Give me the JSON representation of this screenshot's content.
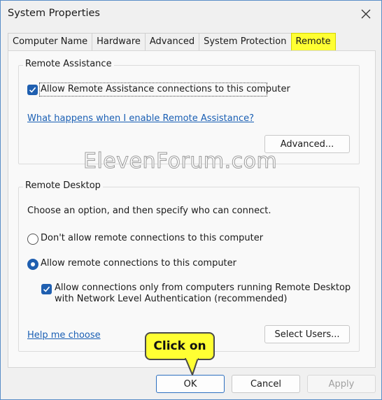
{
  "window": {
    "title": "System Properties"
  },
  "tabs": [
    {
      "label": "Computer Name"
    },
    {
      "label": "Hardware"
    },
    {
      "label": "Advanced"
    },
    {
      "label": "System Protection"
    },
    {
      "label": "Remote"
    }
  ],
  "remote_assistance": {
    "group_label": "Remote Assistance",
    "allow_checkbox_label": "Allow Remote Assistance connections to this computer",
    "allow_checked": true,
    "help_link": "What happens when I enable Remote Assistance?",
    "advanced_button": "Advanced..."
  },
  "remote_desktop": {
    "group_label": "Remote Desktop",
    "instruction": "Choose an option, and then specify who can connect.",
    "option_dont_allow": "Don't allow remote connections to this computer",
    "option_allow": "Allow remote connections to this computer",
    "nla_line1": "Allow connections only from computers running Remote Desktop",
    "nla_line2": "with Network Level Authentication (recommended)",
    "nla_checked": true,
    "help_link": "Help me choose",
    "select_users_button": "Select Users..."
  },
  "footer": {
    "ok_label": "OK",
    "cancel_label": "Cancel",
    "apply_label": "Apply"
  },
  "annotations": {
    "watermark": "ElevenForum.com",
    "callout_text": "Click on"
  },
  "colors": {
    "accent": "#1f5fb0",
    "link": "#1a5fb4",
    "highlight": "#ffff33"
  }
}
